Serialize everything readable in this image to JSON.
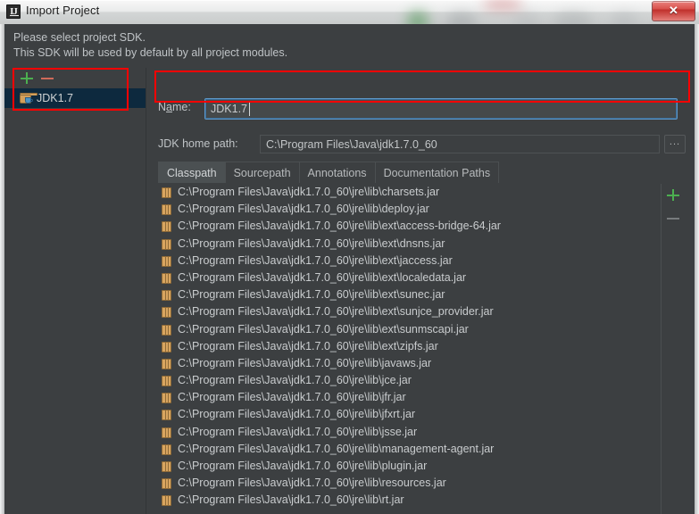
{
  "window": {
    "title": "Import Project",
    "app_icon": "intellij-idea-icon",
    "close_label": "✕"
  },
  "prompt": {
    "line1": "Please select project SDK.",
    "line2": "This SDK will be used by default by all project modules."
  },
  "sdk_panel": {
    "add_label": "+",
    "remove_label": "−",
    "items": [
      {
        "label": "JDK1.7",
        "icon": "jdk-folder-icon",
        "selected": true
      }
    ]
  },
  "detail": {
    "name_label_pre": "N",
    "name_label_mnemonic": "a",
    "name_label_post": "me:",
    "name_value": "JDK1.7",
    "name_placeholder": "",
    "home_path_label": "JDK home path:",
    "home_path_value": "C:\\Program Files\\Java\\jdk1.7.0_60",
    "browse_label": "...",
    "tabs": [
      {
        "label": "Classpath",
        "active": true
      },
      {
        "label": "Sourcepath",
        "active": false
      },
      {
        "label": "Annotations",
        "active": false
      },
      {
        "label": "Documentation Paths",
        "active": false
      }
    ],
    "classpath_add_label": "+",
    "classpath_remove_label": "−",
    "classpath_entries": [
      "C:\\Program Files\\Java\\jdk1.7.0_60\\jre\\lib\\charsets.jar",
      "C:\\Program Files\\Java\\jdk1.7.0_60\\jre\\lib\\deploy.jar",
      "C:\\Program Files\\Java\\jdk1.7.0_60\\jre\\lib\\ext\\access-bridge-64.jar",
      "C:\\Program Files\\Java\\jdk1.7.0_60\\jre\\lib\\ext\\dnsns.jar",
      "C:\\Program Files\\Java\\jdk1.7.0_60\\jre\\lib\\ext\\jaccess.jar",
      "C:\\Program Files\\Java\\jdk1.7.0_60\\jre\\lib\\ext\\localedata.jar",
      "C:\\Program Files\\Java\\jdk1.7.0_60\\jre\\lib\\ext\\sunec.jar",
      "C:\\Program Files\\Java\\jdk1.7.0_60\\jre\\lib\\ext\\sunjce_provider.jar",
      "C:\\Program Files\\Java\\jdk1.7.0_60\\jre\\lib\\ext\\sunmscapi.jar",
      "C:\\Program Files\\Java\\jdk1.7.0_60\\jre\\lib\\ext\\zipfs.jar",
      "C:\\Program Files\\Java\\jdk1.7.0_60\\jre\\lib\\javaws.jar",
      "C:\\Program Files\\Java\\jdk1.7.0_60\\jre\\lib\\jce.jar",
      "C:\\Program Files\\Java\\jdk1.7.0_60\\jre\\lib\\jfr.jar",
      "C:\\Program Files\\Java\\jdk1.7.0_60\\jre\\lib\\jfxrt.jar",
      "C:\\Program Files\\Java\\jdk1.7.0_60\\jre\\lib\\jsse.jar",
      "C:\\Program Files\\Java\\jdk1.7.0_60\\jre\\lib\\management-agent.jar",
      "C:\\Program Files\\Java\\jdk1.7.0_60\\jre\\lib\\plugin.jar",
      "C:\\Program Files\\Java\\jdk1.7.0_60\\jre\\lib\\resources.jar",
      "C:\\Program Files\\Java\\jdk1.7.0_60\\jre\\lib\\rt.jar"
    ]
  },
  "colors": {
    "dialog_background": "#3c3f41",
    "selection_background": "#0d293e",
    "accent_add": "#4caf50",
    "accent_remove": "#cf6a5a",
    "focus_border": "#5e98c8",
    "annotation": "#ff0000",
    "jar_icon": "#d8a560"
  }
}
